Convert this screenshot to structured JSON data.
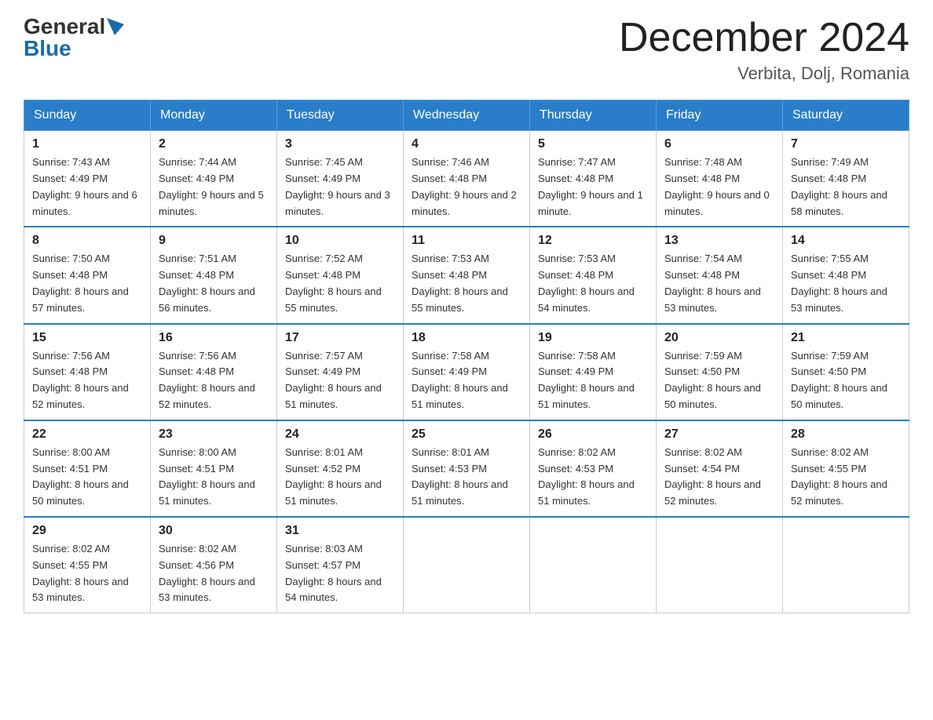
{
  "header": {
    "logo_general": "General",
    "logo_blue": "Blue",
    "month_title": "December 2024",
    "location": "Verbita, Dolj, Romania"
  },
  "weekdays": [
    "Sunday",
    "Monday",
    "Tuesday",
    "Wednesday",
    "Thursday",
    "Friday",
    "Saturday"
  ],
  "weeks": [
    [
      {
        "day": "1",
        "sunrise": "7:43 AM",
        "sunset": "4:49 PM",
        "daylight": "9 hours and 6 minutes."
      },
      {
        "day": "2",
        "sunrise": "7:44 AM",
        "sunset": "4:49 PM",
        "daylight": "9 hours and 5 minutes."
      },
      {
        "day": "3",
        "sunrise": "7:45 AM",
        "sunset": "4:49 PM",
        "daylight": "9 hours and 3 minutes."
      },
      {
        "day": "4",
        "sunrise": "7:46 AM",
        "sunset": "4:48 PM",
        "daylight": "9 hours and 2 minutes."
      },
      {
        "day": "5",
        "sunrise": "7:47 AM",
        "sunset": "4:48 PM",
        "daylight": "9 hours and 1 minute."
      },
      {
        "day": "6",
        "sunrise": "7:48 AM",
        "sunset": "4:48 PM",
        "daylight": "9 hours and 0 minutes."
      },
      {
        "day": "7",
        "sunrise": "7:49 AM",
        "sunset": "4:48 PM",
        "daylight": "8 hours and 58 minutes."
      }
    ],
    [
      {
        "day": "8",
        "sunrise": "7:50 AM",
        "sunset": "4:48 PM",
        "daylight": "8 hours and 57 minutes."
      },
      {
        "day": "9",
        "sunrise": "7:51 AM",
        "sunset": "4:48 PM",
        "daylight": "8 hours and 56 minutes."
      },
      {
        "day": "10",
        "sunrise": "7:52 AM",
        "sunset": "4:48 PM",
        "daylight": "8 hours and 55 minutes."
      },
      {
        "day": "11",
        "sunrise": "7:53 AM",
        "sunset": "4:48 PM",
        "daylight": "8 hours and 55 minutes."
      },
      {
        "day": "12",
        "sunrise": "7:53 AM",
        "sunset": "4:48 PM",
        "daylight": "8 hours and 54 minutes."
      },
      {
        "day": "13",
        "sunrise": "7:54 AM",
        "sunset": "4:48 PM",
        "daylight": "8 hours and 53 minutes."
      },
      {
        "day": "14",
        "sunrise": "7:55 AM",
        "sunset": "4:48 PM",
        "daylight": "8 hours and 53 minutes."
      }
    ],
    [
      {
        "day": "15",
        "sunrise": "7:56 AM",
        "sunset": "4:48 PM",
        "daylight": "8 hours and 52 minutes."
      },
      {
        "day": "16",
        "sunrise": "7:56 AM",
        "sunset": "4:48 PM",
        "daylight": "8 hours and 52 minutes."
      },
      {
        "day": "17",
        "sunrise": "7:57 AM",
        "sunset": "4:49 PM",
        "daylight": "8 hours and 51 minutes."
      },
      {
        "day": "18",
        "sunrise": "7:58 AM",
        "sunset": "4:49 PM",
        "daylight": "8 hours and 51 minutes."
      },
      {
        "day": "19",
        "sunrise": "7:58 AM",
        "sunset": "4:49 PM",
        "daylight": "8 hours and 51 minutes."
      },
      {
        "day": "20",
        "sunrise": "7:59 AM",
        "sunset": "4:50 PM",
        "daylight": "8 hours and 50 minutes."
      },
      {
        "day": "21",
        "sunrise": "7:59 AM",
        "sunset": "4:50 PM",
        "daylight": "8 hours and 50 minutes."
      }
    ],
    [
      {
        "day": "22",
        "sunrise": "8:00 AM",
        "sunset": "4:51 PM",
        "daylight": "8 hours and 50 minutes."
      },
      {
        "day": "23",
        "sunrise": "8:00 AM",
        "sunset": "4:51 PM",
        "daylight": "8 hours and 51 minutes."
      },
      {
        "day": "24",
        "sunrise": "8:01 AM",
        "sunset": "4:52 PM",
        "daylight": "8 hours and 51 minutes."
      },
      {
        "day": "25",
        "sunrise": "8:01 AM",
        "sunset": "4:53 PM",
        "daylight": "8 hours and 51 minutes."
      },
      {
        "day": "26",
        "sunrise": "8:02 AM",
        "sunset": "4:53 PM",
        "daylight": "8 hours and 51 minutes."
      },
      {
        "day": "27",
        "sunrise": "8:02 AM",
        "sunset": "4:54 PM",
        "daylight": "8 hours and 52 minutes."
      },
      {
        "day": "28",
        "sunrise": "8:02 AM",
        "sunset": "4:55 PM",
        "daylight": "8 hours and 52 minutes."
      }
    ],
    [
      {
        "day": "29",
        "sunrise": "8:02 AM",
        "sunset": "4:55 PM",
        "daylight": "8 hours and 53 minutes."
      },
      {
        "day": "30",
        "sunrise": "8:02 AM",
        "sunset": "4:56 PM",
        "daylight": "8 hours and 53 minutes."
      },
      {
        "day": "31",
        "sunrise": "8:03 AM",
        "sunset": "4:57 PM",
        "daylight": "8 hours and 54 minutes."
      },
      null,
      null,
      null,
      null
    ]
  ],
  "labels": {
    "sunrise": "Sunrise:",
    "sunset": "Sunset:",
    "daylight": "Daylight:"
  }
}
